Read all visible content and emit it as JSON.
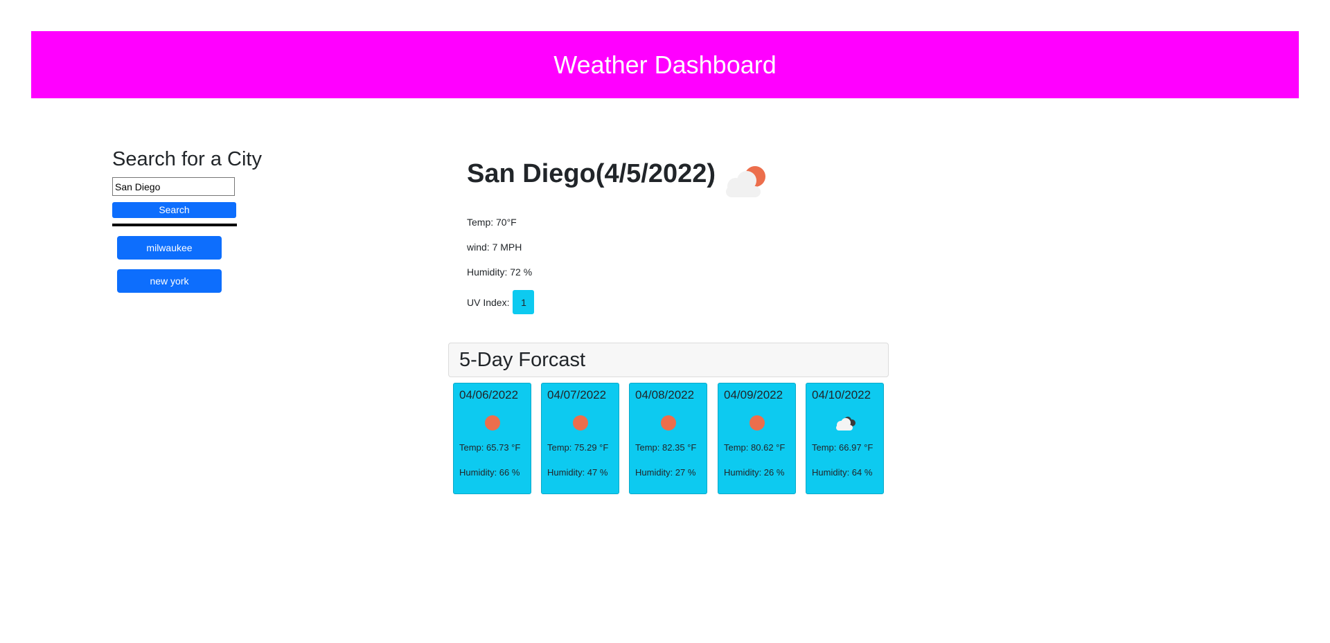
{
  "header": {
    "title": "Weather Dashboard",
    "background": "#ff00ff"
  },
  "sidebar": {
    "title": "Search for a City",
    "search_input": {
      "value": "San Diego",
      "placeholder": ""
    },
    "search_button": "Search",
    "history": [
      {
        "label": "milwaukee"
      },
      {
        "label": "new york"
      }
    ]
  },
  "current": {
    "title": "San Diego(4/5/2022)",
    "icon": "partly-cloudy-day-icon",
    "temp": "Temp: 70°F",
    "wind": "wind: 7 MPH",
    "humidity": "Humidity: 72 %",
    "uv_label": "UV Index:",
    "uv_value": "1",
    "uv_color": "#0dcaf0"
  },
  "forecast": {
    "title": "5-Day Forcast",
    "days": [
      {
        "date": "04/06/2022",
        "icon": "sun-icon",
        "temp": "Temp: 65.73 °F",
        "humidity": "Humidity: 66 %"
      },
      {
        "date": "04/07/2022",
        "icon": "sun-icon",
        "temp": "Temp: 75.29 °F",
        "humidity": "Humidity: 47 %"
      },
      {
        "date": "04/08/2022",
        "icon": "sun-icon",
        "temp": "Temp: 82.35 °F",
        "humidity": "Humidity: 27 %"
      },
      {
        "date": "04/09/2022",
        "icon": "sun-icon",
        "temp": "Temp: 80.62 °F",
        "humidity": "Humidity: 26 %"
      },
      {
        "date": "04/10/2022",
        "icon": "broken-clouds-icon",
        "temp": "Temp: 66.97 °F",
        "humidity": "Humidity: 64 %"
      }
    ]
  }
}
